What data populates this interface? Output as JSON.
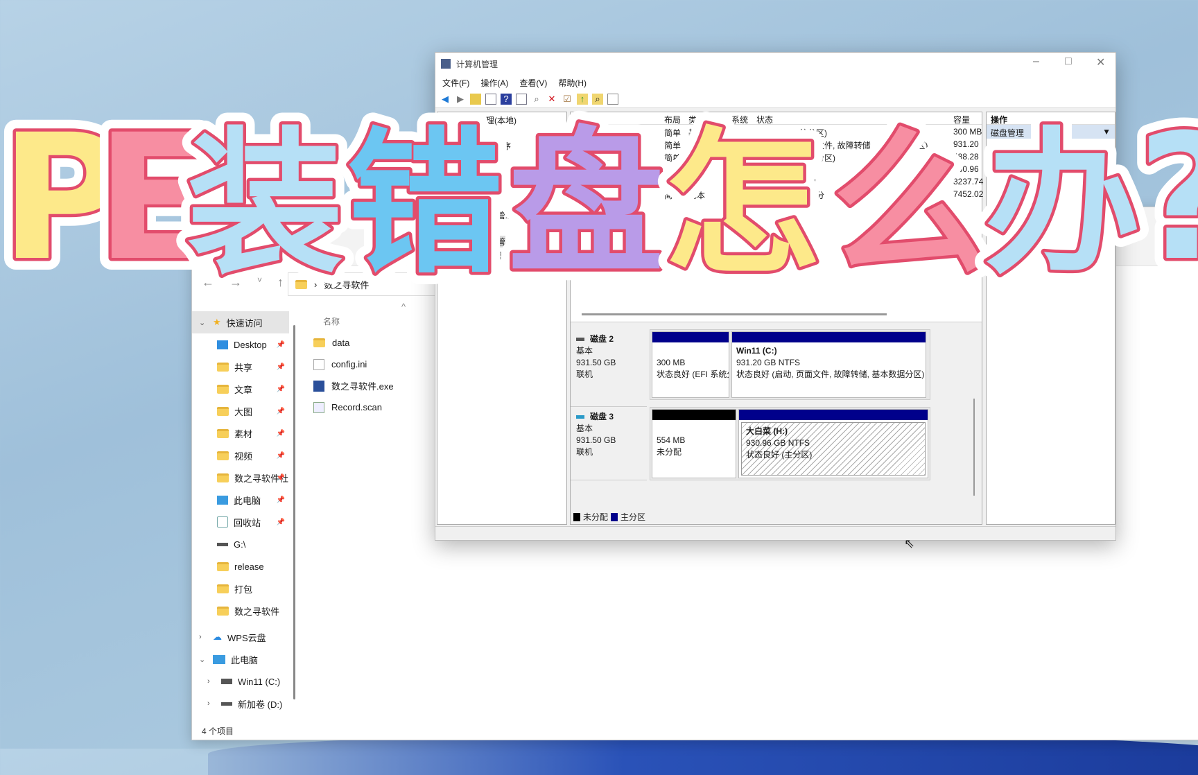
{
  "overlay_title": {
    "chars": [
      {
        "c": "P",
        "color": "#fde98a"
      },
      {
        "c": "E",
        "color": "#f78ea2"
      },
      {
        "c": "装",
        "color": "#b6e0f6"
      },
      {
        "c": "错",
        "color": "#6cc6f2"
      },
      {
        "c": "盘",
        "color": "#b99be8"
      },
      {
        "c": "怎",
        "color": "#fde98a"
      },
      {
        "c": "么",
        "color": "#f78ea2"
      },
      {
        "c": "办",
        "color": "#b6e0f6"
      },
      {
        "c": "?",
        "color": "#b6e0f6"
      }
    ],
    "stroke": "#e24c6c",
    "outline": "#ffffff"
  },
  "explorer": {
    "address": "数之寻软件",
    "nav": [
      "←",
      "→",
      "˅",
      "↑"
    ],
    "column_name": "名称",
    "quick_access": "快速访问",
    "sidebar": [
      {
        "label": "Desktop",
        "icon": "desktop-icon"
      },
      {
        "label": "共享",
        "icon": "folder-icon"
      },
      {
        "label": "文章",
        "icon": "folder-icon"
      },
      {
        "label": "大图",
        "icon": "folder-icon"
      },
      {
        "label": "素材",
        "icon": "folder-icon"
      },
      {
        "label": "视频",
        "icon": "folder-icon"
      },
      {
        "label": "数之寻软件社",
        "icon": "folder-icon"
      },
      {
        "label": "此电脑",
        "icon": "monitor-icon"
      },
      {
        "label": "回收站",
        "icon": "recycle-bin-icon"
      },
      {
        "label": "G:\\",
        "icon": "drive-icon"
      },
      {
        "label": "release",
        "icon": "folder-icon"
      },
      {
        "label": "打包",
        "icon": "folder-icon"
      },
      {
        "label": "数之寻软件",
        "icon": "folder-icon"
      }
    ],
    "wps": "WPS云盘",
    "this_pc": "此电脑",
    "drives": [
      "Win11 (C:)",
      "新加卷 (D:)"
    ],
    "files": [
      {
        "name": "data",
        "icon": "folder-icon"
      },
      {
        "name": "config.ini",
        "icon": "settings-file-icon"
      },
      {
        "name": "数之寻软件.exe",
        "icon": "exe-icon"
      },
      {
        "name": "Record.scan",
        "icon": "edit-file-icon"
      }
    ],
    "status": "4 个项目",
    "tab_fragment": "数之寻"
  },
  "compmgmt": {
    "title": "计算机管理",
    "menu": [
      "文件(F)",
      "操作(A)",
      "查看(V)",
      "帮助(H)"
    ],
    "tree": [
      "理(本地)",
      "划程序",
      "管理器",
      "管",
      "理"
    ],
    "columns": [
      "布局",
      "类型",
      "系统",
      "状态",
      "容量"
    ],
    "rows": [
      {
        "layout": "简单",
        "type": "基本",
        "fs": "",
        "status": "统分区)",
        "cap": "300 MB"
      },
      {
        "layout": "简单",
        "type": "",
        "fs": "",
        "status": "页面文件, 故障转储, 基本数据分区)",
        "cap": "931.20"
      },
      {
        "layout": "简单",
        "type": "",
        "fs": "N",
        "status": "数据分区)",
        "cap": "488.28"
      },
      {
        "layout": "简单",
        "type": "",
        "fs": "N",
        "status": "区)",
        "cap": "930.96"
      },
      {
        "layout": "简单",
        "type": "基本",
        "fs": "N",
        "status": "数据",
        "cap": "3237.74"
      },
      {
        "layout": "简单",
        "type": "基本",
        "fs": "N",
        "status": "数据分",
        "cap": "7452.02"
      }
    ],
    "actions_header": "操作",
    "action": "磁盘管理",
    "disks": [
      {
        "name": "磁盘 2",
        "kind": "基本",
        "size": "931.50 GB",
        "state": "联机",
        "parts": [
          {
            "size": "300 MB",
            "status": "状态良好 (EFI 系统分区)",
            "bar": "#00008b"
          },
          {
            "label": "Win11  (C:)",
            "size": "931.20 GB NTFS",
            "status": "状态良好 (启动, 页面文件, 故障转储, 基本数据分区)",
            "bar": "#00008b"
          }
        ]
      },
      {
        "name": "磁盘 3",
        "kind": "基本",
        "size": "931.50 GB",
        "state": "联机",
        "parts": [
          {
            "size": "554 MB",
            "status": "未分配",
            "bar": "#000000"
          },
          {
            "label": "大白菜  (H:)",
            "size": "930.96 GB NTFS",
            "status": "状态良好 (主分区)",
            "bar": "#00008b"
          }
        ]
      }
    ],
    "legend": [
      {
        "label": "未分配",
        "color": "#000000"
      },
      {
        "label": "主分区",
        "color": "#00008b"
      }
    ]
  }
}
